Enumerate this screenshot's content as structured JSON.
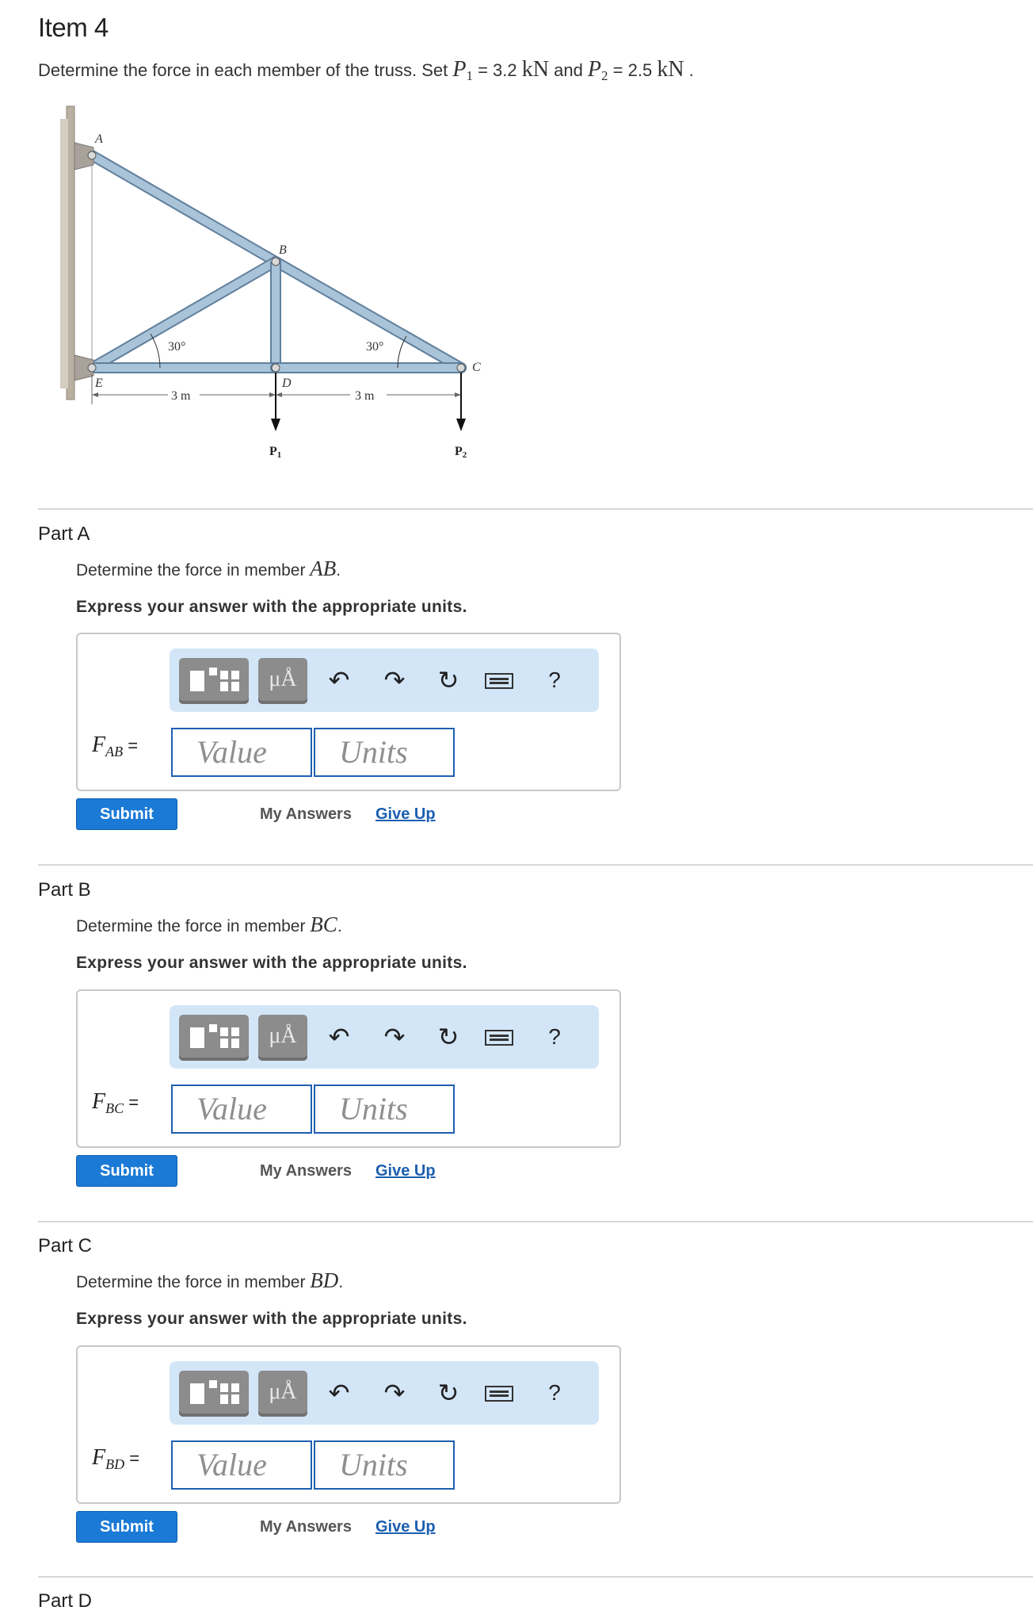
{
  "item_title": "Item 4",
  "problem": {
    "text_before": "Determine the force in each member of the truss. Set ",
    "p1_symbol": "P",
    "p1_sub": "1",
    "p1_eq": " = 3.2 ",
    "unit1": "kN",
    "and": " and ",
    "p2_symbol": "P",
    "p2_sub": "2",
    "p2_eq": " = 2.5 ",
    "unit2": "kN",
    "end": " ."
  },
  "figure": {
    "labels": {
      "A": "A",
      "B": "B",
      "C": "C",
      "D": "D",
      "E": "E"
    },
    "angle_left": "30°",
    "angle_right": "30°",
    "dim_left": "3 m",
    "dim_right": "3 m",
    "load1": "P",
    "load1_sub": "1",
    "load2": "P",
    "load2_sub": "2"
  },
  "toolbar": {
    "units_btn": "μÅ",
    "help": "?"
  },
  "parts": [
    {
      "title": "Part A",
      "prompt_before": "Determine the force in member ",
      "member": "AB",
      "prompt_after": ".",
      "instruction": "Express your answer with the appropriate units.",
      "var": "F",
      "var_sub": "AB",
      "eq": " =",
      "value_placeholder": "Value",
      "units_placeholder": "Units",
      "submit": "Submit",
      "my_answers": "My Answers",
      "give_up": "Give Up"
    },
    {
      "title": "Part B",
      "prompt_before": "Determine the force in member ",
      "member": "BC",
      "prompt_after": ".",
      "instruction": "Express your answer with the appropriate units.",
      "var": "F",
      "var_sub": "BC",
      "eq": " =",
      "value_placeholder": "Value",
      "units_placeholder": "Units",
      "submit": "Submit",
      "my_answers": "My Answers",
      "give_up": "Give Up"
    },
    {
      "title": "Part C",
      "prompt_before": "Determine the force in member ",
      "member": "BD",
      "prompt_after": ".",
      "instruction": "Express your answer with the appropriate units.",
      "var": "F",
      "var_sub": "BD",
      "eq": " =",
      "value_placeholder": "Value",
      "units_placeholder": "Units",
      "submit": "Submit",
      "my_answers": "My Answers",
      "give_up": "Give Up"
    }
  ],
  "part_d_title": "Part D",
  "colors": {
    "member_fill": "#a9c3d9",
    "member_stroke": "#5f7f9c",
    "accent": "#1b7ad6",
    "toolbar_bg": "#d3e6f8",
    "field_border": "#1f5fb0"
  }
}
